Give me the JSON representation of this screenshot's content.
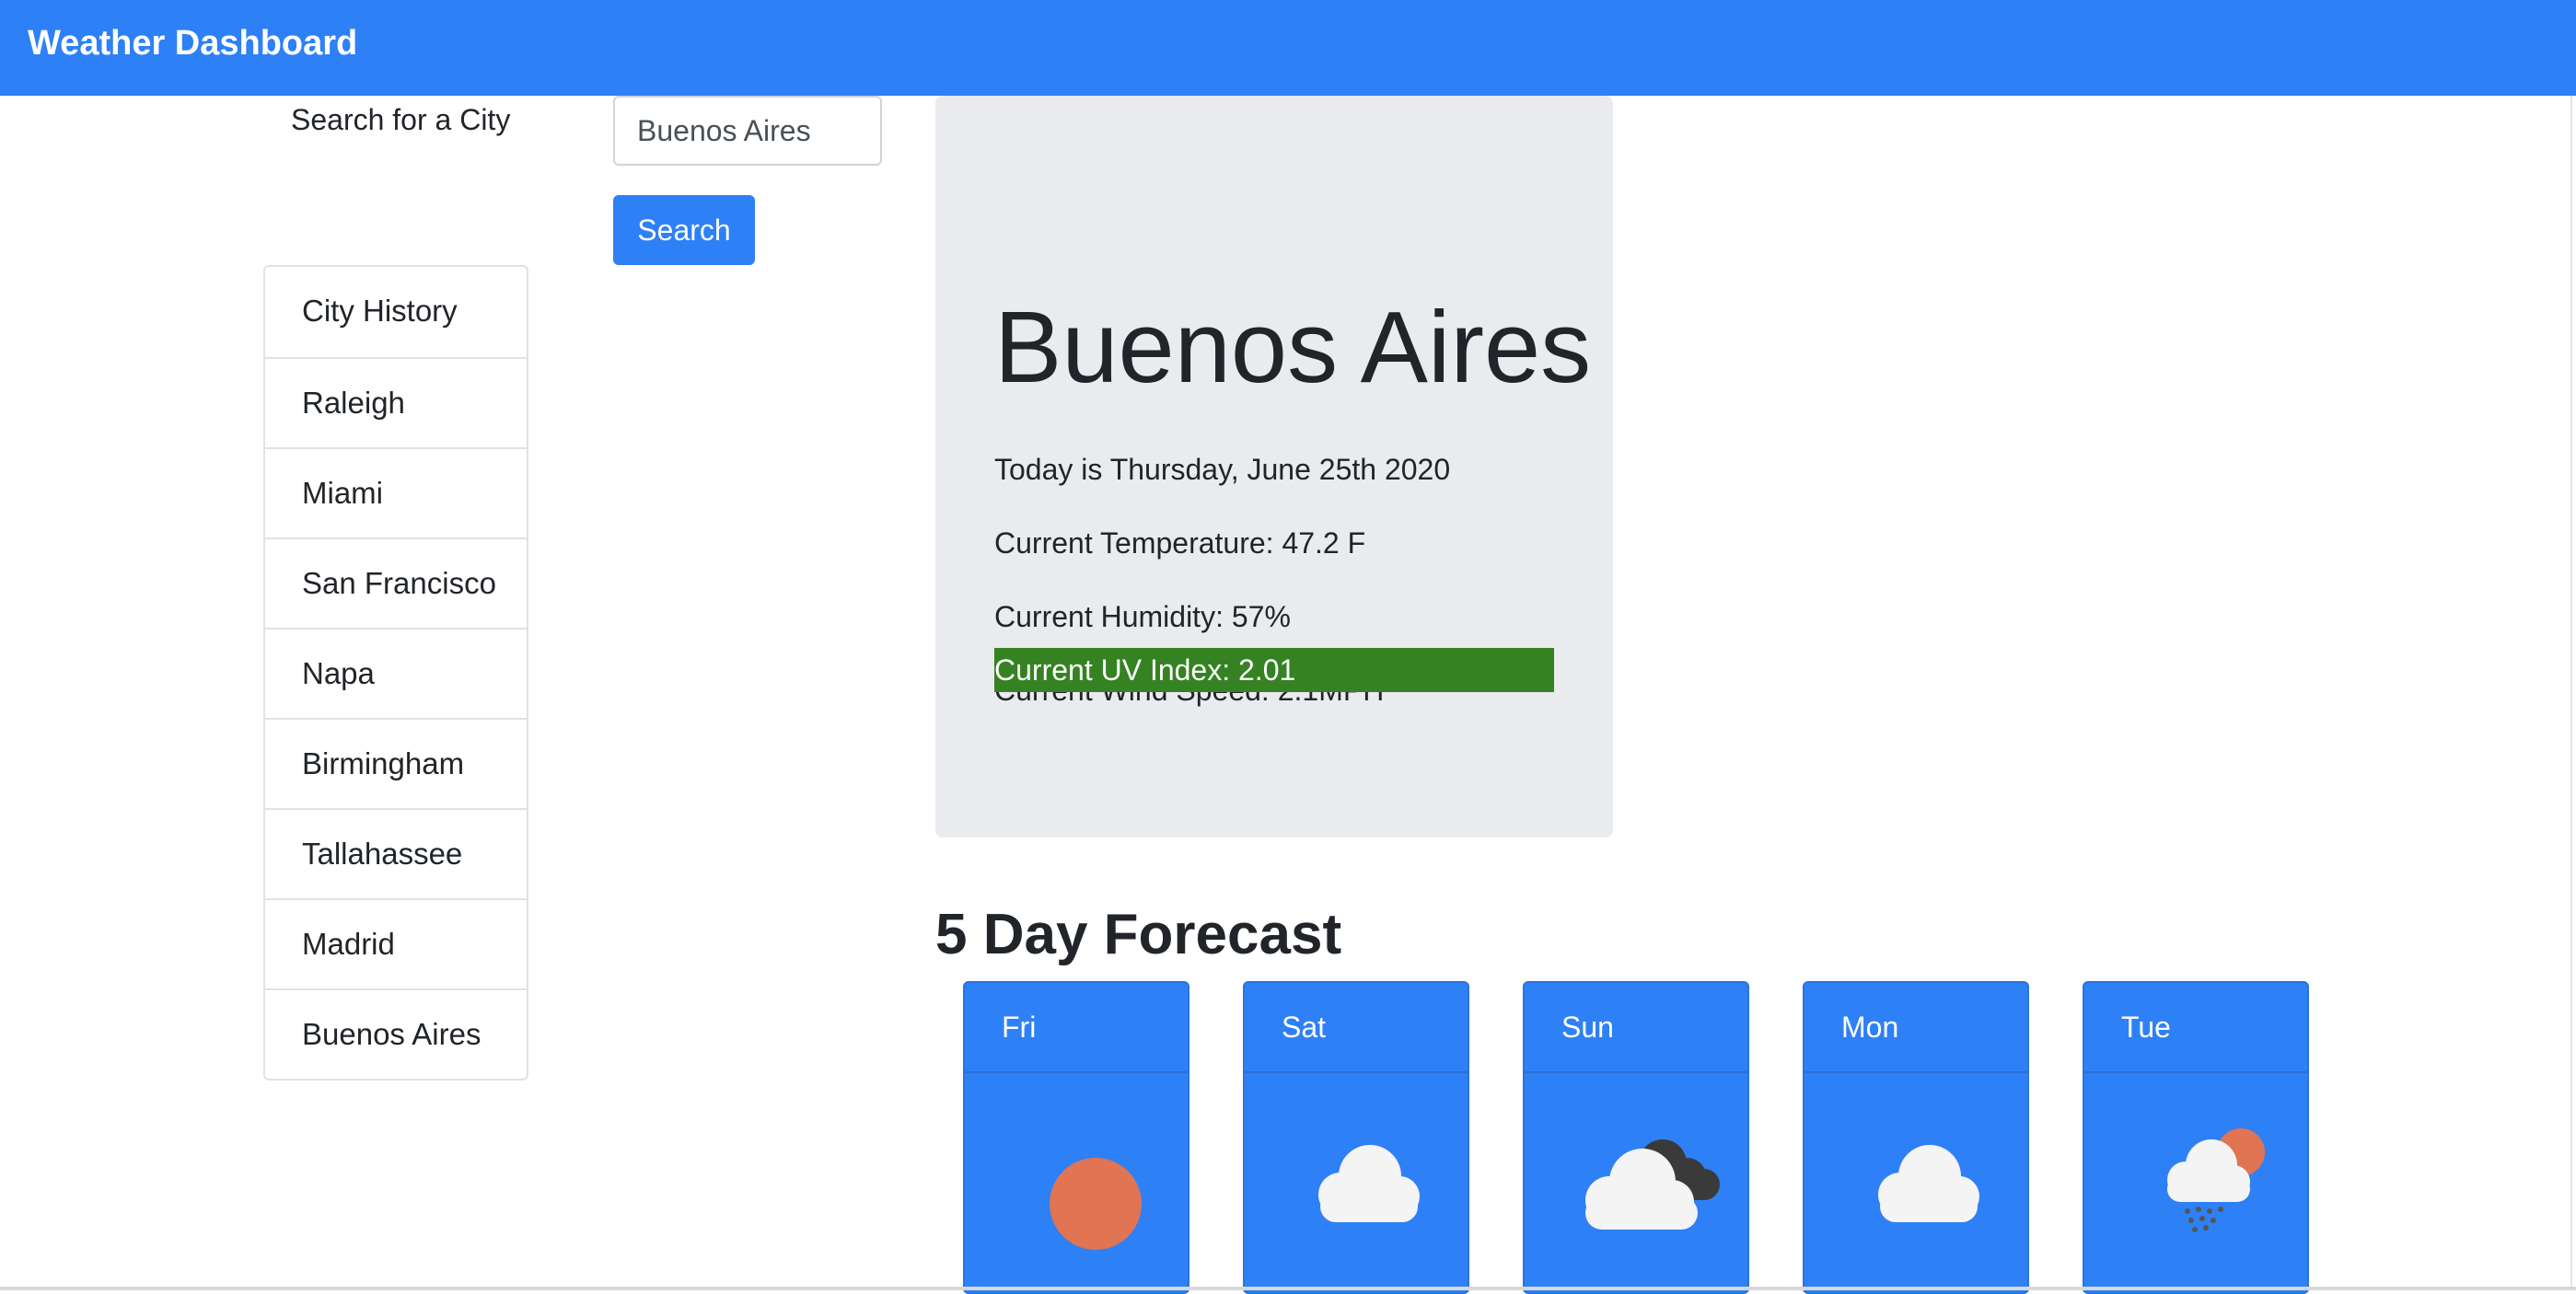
{
  "app": {
    "title": "Weather Dashboard"
  },
  "search": {
    "label": "Search for a City",
    "value": "Buenos Aires",
    "button_label": "Search"
  },
  "history": {
    "items": [
      "City History",
      "Raleigh",
      "Miami",
      "San Francisco",
      "Napa",
      "Birmingham",
      "Tallahassee",
      "Madrid",
      "Buenos Aires"
    ]
  },
  "current": {
    "city": "Buenos Aires",
    "date_text": "Today is Thursday, June 25th 2020",
    "temperature_text": "Current Temperature: 47.2 F",
    "humidity_text": "Current Humidity: 57%",
    "wind_text": "Current Wind Speed: 2.1MPH",
    "uv_text": "Current UV Index: 2.01",
    "uv_color": "#348222"
  },
  "forecast": {
    "title": "5 Day Forecast",
    "days": [
      {
        "day": "Fri",
        "icon": "sun-icon"
      },
      {
        "day": "Sat",
        "icon": "cloud-icon"
      },
      {
        "day": "Sun",
        "icon": "dark-cloud-icon"
      },
      {
        "day": "Mon",
        "icon": "cloud-icon"
      },
      {
        "day": "Tue",
        "icon": "rain-sun-icon"
      }
    ]
  },
  "colors": {
    "brand": "#2e80f6",
    "card_bg": "#e9ebee",
    "sun": "#e07453",
    "cloud": "#f4f4f4",
    "dark_cloud": "#3a3a3a"
  }
}
